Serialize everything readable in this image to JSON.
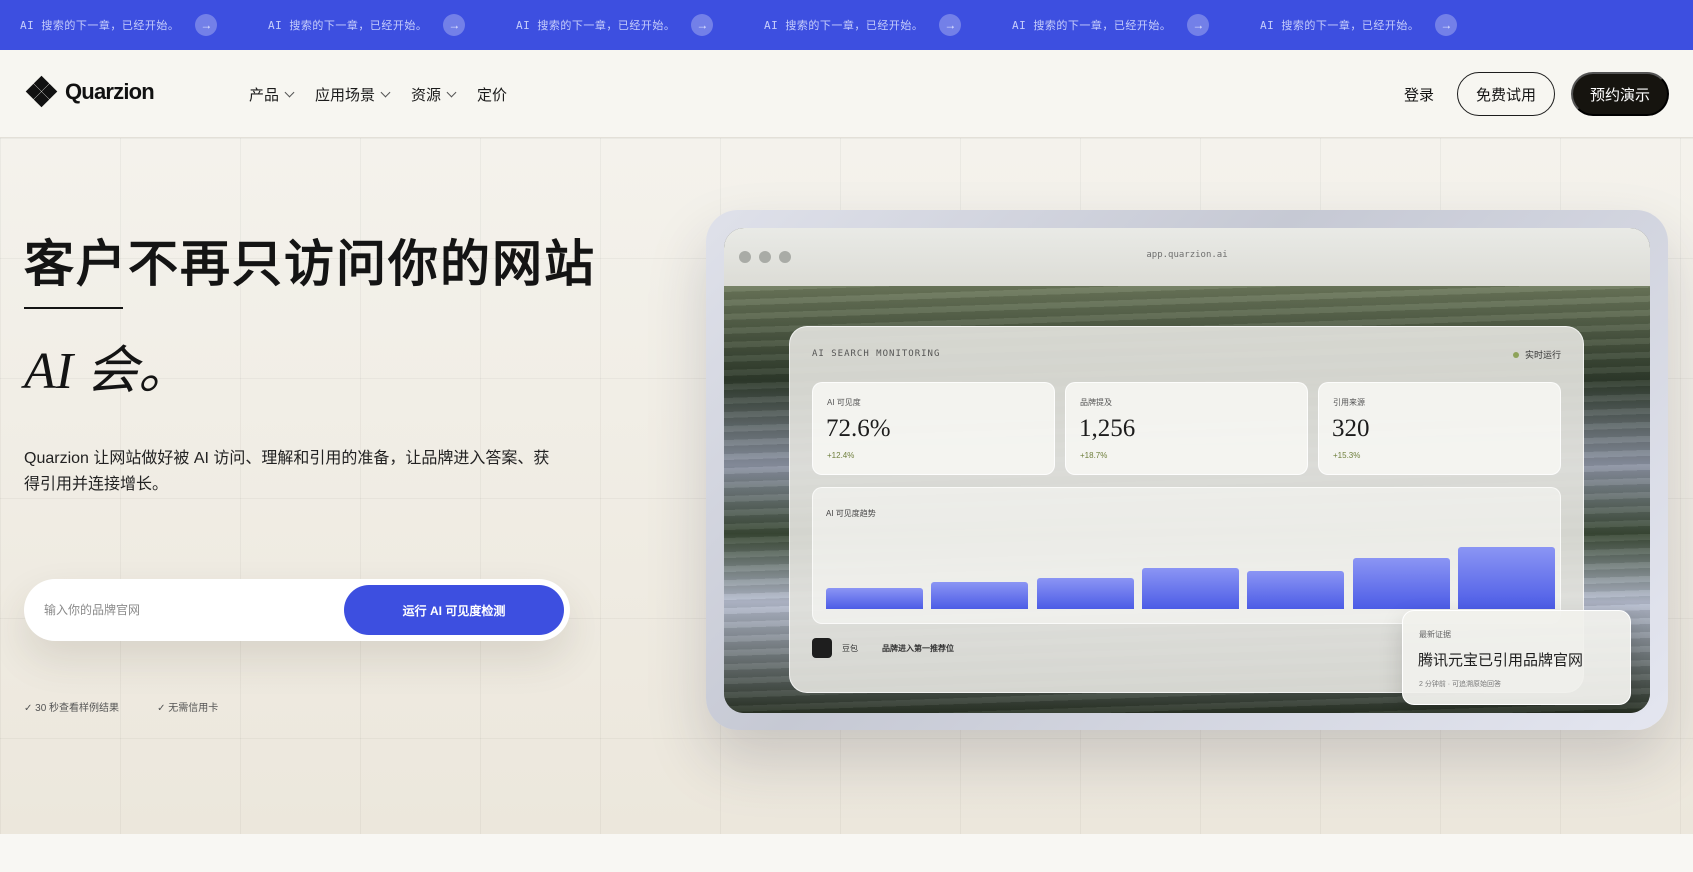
{
  "marquee": {
    "items": [
      "AI 搜索的下一章，已经开始。",
      "AI 搜索的下一章，已经开始。",
      "AI 搜索的下一章，已经开始。",
      "AI 搜索的下一章，已经开始。",
      "AI 搜索的下一章，已经开始。",
      "AI 搜索的下一章，已经开始。",
      "AI 搜索的下一章，已经开始。"
    ],
    "arrow_icon": "arrow-right-icon"
  },
  "header": {
    "brand": "Quarzion",
    "nav": [
      {
        "label": "产品",
        "has_dropdown": true
      },
      {
        "label": "应用场景",
        "has_dropdown": true
      },
      {
        "label": "资源",
        "has_dropdown": true
      },
      {
        "label": "定价",
        "has_dropdown": false
      }
    ],
    "login": "登录",
    "trial": "免费试用",
    "demo": "预约演示"
  },
  "hero": {
    "headline_line1": "客户不再只访问你的网站",
    "headline_line2": "AI 会。",
    "lead": "Quarzion 让网站做好被 AI 访问、理解和引用的准备，让品牌进入答案、获得引用并连接增长。",
    "search_placeholder": "输入你的品牌官网",
    "search_button": "运行 AI 可见度检测",
    "checks": [
      "✓ 30 秒查看样例结果",
      "✓ 无需信用卡"
    ]
  },
  "mockup": {
    "url": "app.quarzion.ai",
    "dashboard_title": "AI SEARCH MONITORING",
    "status": "实时运行",
    "kpis": [
      {
        "label": "AI 可见度",
        "value": "72.6%",
        "delta": "+12.4%"
      },
      {
        "label": "品牌提及",
        "value": "1,256",
        "delta": "+18.7%"
      },
      {
        "label": "引用来源",
        "value": "320",
        "delta": "+15.3%"
      }
    ],
    "trend_label": "AI 可见度趋势",
    "trend_levels": [
      0.23,
      0.3,
      0.34,
      0.45,
      0.42,
      0.57,
      0.69
    ],
    "footer_source": "豆包",
    "footer_text": "品牌进入第一推荐位",
    "evidence": {
      "label": "最新证据",
      "title": "腾讯元宝已引用品牌官网",
      "sub": "2 分钟前 · 可追溯原始回答"
    }
  },
  "colors": {
    "accent": "#3d4fe0",
    "dark": "#16140f",
    "live": "#8ea35a"
  }
}
